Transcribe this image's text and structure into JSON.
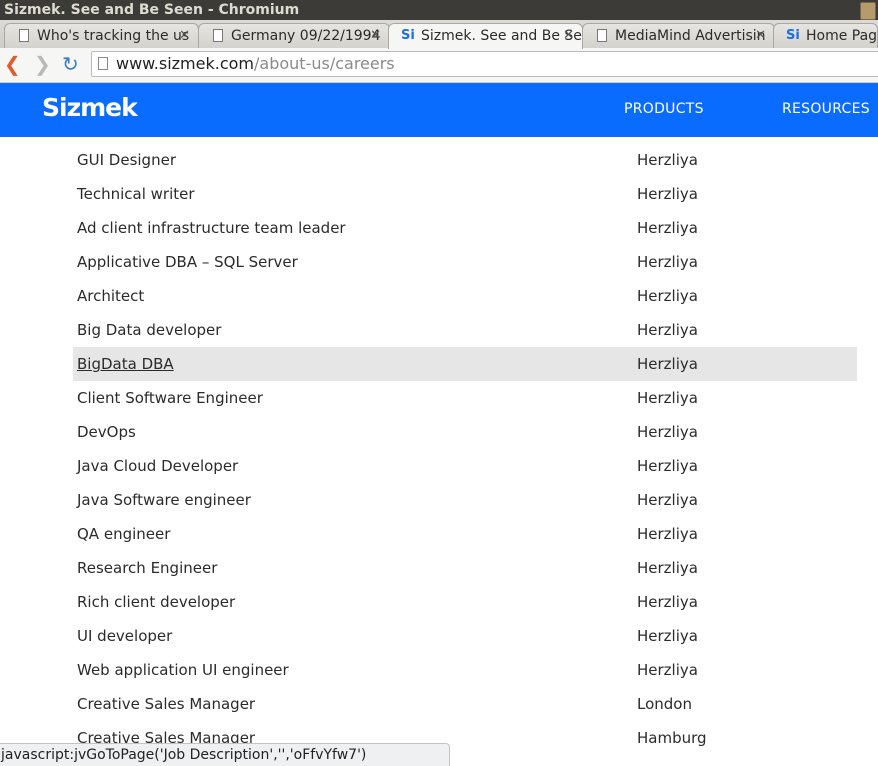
{
  "window": {
    "title": "Sizmek. See and Be Seen - Chromium"
  },
  "tabs": [
    {
      "label": "Who's tracking the us",
      "icon": "page-icon"
    },
    {
      "label": "Germany 09/22/1994",
      "icon": "page-icon"
    },
    {
      "label": "Sizmek. See and Be Se",
      "icon": "sizmek-favicon",
      "active": true
    },
    {
      "label": "MediaMind Advertisin",
      "icon": "page-icon"
    },
    {
      "label": "Home Page",
      "icon": "sizmek-favicon"
    }
  ],
  "toolbar": {
    "url_host": "www.sizmek.com",
    "url_path": "/about-us/careers"
  },
  "header": {
    "logo": "Sizmek",
    "nav": [
      "PRODUCTS",
      "RESOURCES"
    ],
    "brand_color": "#0a6cff"
  },
  "jobs": [
    {
      "title": "GUI Designer",
      "location": "Herzliya"
    },
    {
      "title": "Technical writer",
      "location": "Herzliya"
    },
    {
      "title": "Ad client infrastructure team leader",
      "location": "Herzliya"
    },
    {
      "title": "Applicative DBA – SQL Server",
      "location": "Herzliya"
    },
    {
      "title": "Architect",
      "location": "Herzliya"
    },
    {
      "title": "Big Data developer",
      "location": "Herzliya"
    },
    {
      "title": "BigData DBA",
      "location": "Herzliya",
      "hovered": true
    },
    {
      "title": "Client Software Engineer",
      "location": "Herzliya"
    },
    {
      "title": "DevOps",
      "location": "Herzliya"
    },
    {
      "title": "Java Cloud Developer",
      "location": "Herzliya"
    },
    {
      "title": "Java Software engineer",
      "location": "Herzliya"
    },
    {
      "title": "QA engineer",
      "location": "Herzliya"
    },
    {
      "title": "Research Engineer",
      "location": "Herzliya"
    },
    {
      "title": "Rich client developer",
      "location": "Herzliya"
    },
    {
      "title": "UI developer",
      "location": "Herzliya"
    },
    {
      "title": "Web application UI engineer",
      "location": "Herzliya"
    },
    {
      "title": "Creative Sales Manager",
      "location": "London"
    },
    {
      "title": "Creative Sales Manager",
      "location": "Hamburg"
    }
  ],
  "status": {
    "text": "javascript:jvGoToPage('Job Description','','oFfvYfw7')"
  }
}
